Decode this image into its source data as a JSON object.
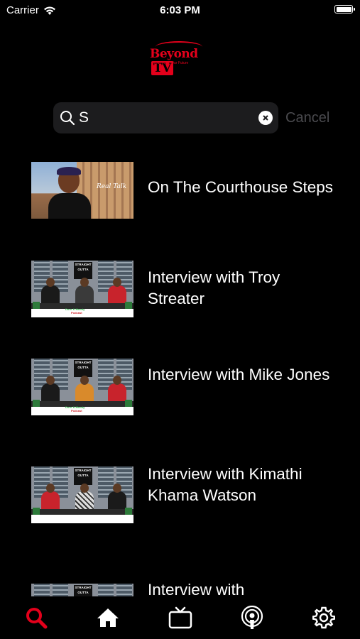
{
  "status_bar": {
    "carrier": "Carrier",
    "time": "6:03 PM"
  },
  "logo": {
    "name_part1": "Beyond",
    "name_part2": "TV",
    "tagline": "Your Voice Our Future"
  },
  "search": {
    "value": "S",
    "placeholder": "Search",
    "cancel_label": "Cancel"
  },
  "results": [
    {
      "title": "On The Courthouse Steps",
      "thumb_text": "Real Talk"
    },
    {
      "title": "Interview with Troy Streater",
      "thumb_text": "STRAIGHT OUTTA"
    },
    {
      "title": "Interview with Mike Jones",
      "thumb_text": "STRAIGHT OUTTA"
    },
    {
      "title": "Interview with Kimathi Khama Watson",
      "thumb_text": "STRAIGHT OUTTA"
    },
    {
      "title": "Interview with",
      "thumb_text": "STRAIGHT OUTTA"
    }
  ],
  "thumb_caption": {
    "line1": "Dorn & Moody",
    "line2": "Podcast"
  },
  "tab_bar": {
    "items": [
      {
        "icon": "search-icon",
        "active": true
      },
      {
        "icon": "home-icon",
        "active": false
      },
      {
        "icon": "tv-icon",
        "active": false
      },
      {
        "icon": "podcast-icon",
        "active": false
      },
      {
        "icon": "gear-icon",
        "active": false
      }
    ]
  },
  "colors": {
    "accent": "#e3001b",
    "background": "#000000",
    "search_field": "#1c1c1e",
    "cancel_text": "#4a4a4e"
  }
}
